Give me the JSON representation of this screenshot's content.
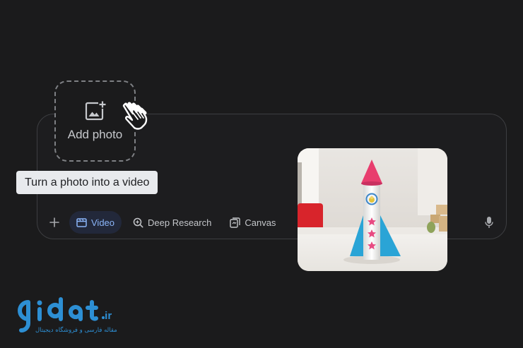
{
  "composer": {
    "toolbar": {
      "add_icon": "plus-icon",
      "chips": [
        {
          "label": "Video",
          "icon": "video-icon",
          "active": true
        },
        {
          "label": "Deep Research",
          "icon": "deep-research-icon",
          "active": false
        },
        {
          "label": "Canvas",
          "icon": "canvas-icon",
          "active": false
        }
      ],
      "mic_icon": "microphone-icon"
    }
  },
  "upload": {
    "label": "Add photo",
    "icon": "add-photo-icon",
    "tooltip": "Turn a photo into a video"
  },
  "preview": {
    "subject": "toy rocket"
  },
  "watermark": {
    "brand": "gidat",
    "tld": ".ir",
    "tagline": "مقاله فارسی و فروشگاه دیجیتال"
  },
  "colors": {
    "background": "#1b1b1c",
    "accent": "#8ab4f8",
    "active_chip_bg": "#22283a",
    "tooltip_bg": "#e8eaed",
    "watermark_blue": "#2d8fd4"
  }
}
